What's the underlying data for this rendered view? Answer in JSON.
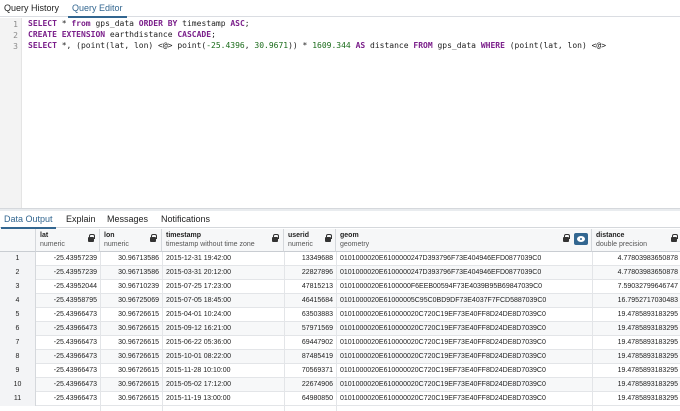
{
  "top_tabs": [
    "Query History",
    "Query Editor"
  ],
  "editor": {
    "line_numbers": [
      "1",
      "2",
      "3"
    ],
    "lines": [
      "SELECT * from gps_data ORDER BY timestamp ASC;",
      "CREATE EXTENSION earthdistance CASCADE;",
      "SELECT *, (point(lat, lon) <@> point(-25.4396, 30.9671)) * 1609.344 AS distance FROM gps_data WHERE (point(lat, lon) <@>"
    ]
  },
  "output_tabs": [
    "Data Output",
    "Explain",
    "Messages",
    "Notifications"
  ],
  "grid": {
    "columns": [
      {
        "name": "lat",
        "type": "numeric"
      },
      {
        "name": "lon",
        "type": "numeric"
      },
      {
        "name": "timestamp",
        "type": "timestamp without time zone"
      },
      {
        "name": "userid",
        "type": "numeric"
      },
      {
        "name": "geom",
        "type": "geometry"
      },
      {
        "name": "distance",
        "type": "double precision"
      }
    ],
    "rows": [
      {
        "n": "1",
        "lat": "-25.43957239",
        "lon": "30.96713586",
        "ts": "2015-12-31 19:42:00",
        "uid": "13349688",
        "geom": "0101000020E6100000247D393796F73E404946EFD0877039C0",
        "dist": "4.77803983650878"
      },
      {
        "n": "2",
        "lat": "-25.43957239",
        "lon": "30.96713586",
        "ts": "2015-03-31 20:12:00",
        "uid": "22827896",
        "geom": "0101000020E6100000247D393796F73E404946EFD0877039C0",
        "dist": "4.77803983650878"
      },
      {
        "n": "3",
        "lat": "-25.43952044",
        "lon": "30.96710239",
        "ts": "2015-07-25 17:23:00",
        "uid": "47815213",
        "geom": "0101000020E6100000F6EEB00594F73E4039B95B69847039C0",
        "dist": "7.59032799646747"
      },
      {
        "n": "4",
        "lat": "-25.43958795",
        "lon": "30.96725069",
        "ts": "2015-07-05 18:45:00",
        "uid": "46415684",
        "geom": "0101000020E61000005C95C0BD9DF73E4037F7FCD5887039C0",
        "dist": "16.7952717030483"
      },
      {
        "n": "5",
        "lat": "-25.43966473",
        "lon": "30.96726615",
        "ts": "2015-04-01 10:24:00",
        "uid": "63503883",
        "geom": "0101000020E610000020C720C19EF73E40FF8D24DE8D7039C0",
        "dist": "19.4785893183295"
      },
      {
        "n": "6",
        "lat": "-25.43966473",
        "lon": "30.96726615",
        "ts": "2015-09-12 16:21:00",
        "uid": "57971569",
        "geom": "0101000020E610000020C720C19EF73E40FF8D24DE8D7039C0",
        "dist": "19.4785893183295"
      },
      {
        "n": "7",
        "lat": "-25.43966473",
        "lon": "30.96726615",
        "ts": "2015-06-22 05:36:00",
        "uid": "69447902",
        "geom": "0101000020E610000020C720C19EF73E40FF8D24DE8D7039C0",
        "dist": "19.4785893183295"
      },
      {
        "n": "8",
        "lat": "-25.43966473",
        "lon": "30.96726615",
        "ts": "2015-10-01 08:22:00",
        "uid": "87485419",
        "geom": "0101000020E610000020C720C19EF73E40FF8D24DE8D7039C0",
        "dist": "19.4785893183295"
      },
      {
        "n": "9",
        "lat": "-25.43966473",
        "lon": "30.96726615",
        "ts": "2015-11-28 10:10:00",
        "uid": "70569371",
        "geom": "0101000020E610000020C720C19EF73E40FF8D24DE8D7039C0",
        "dist": "19.4785893183295"
      },
      {
        "n": "10",
        "lat": "-25.43966473",
        "lon": "30.96726615",
        "ts": "2015-05-02 17:12:00",
        "uid": "22674906",
        "geom": "0101000020E610000020C720C19EF73E40FF8D24DE8D7039C0",
        "dist": "19.4785893183295"
      },
      {
        "n": "11",
        "lat": "-25.43966473",
        "lon": "30.96726615",
        "ts": "2015-11-19 13:00:00",
        "uid": "64980850",
        "geom": "0101000020E610000020C720C19EF73E40FF8D24DE8D7039C0",
        "dist": "19.4785893183295"
      }
    ]
  },
  "colors": {
    "accent": "#326690",
    "keyword": "#7a1e8a"
  }
}
